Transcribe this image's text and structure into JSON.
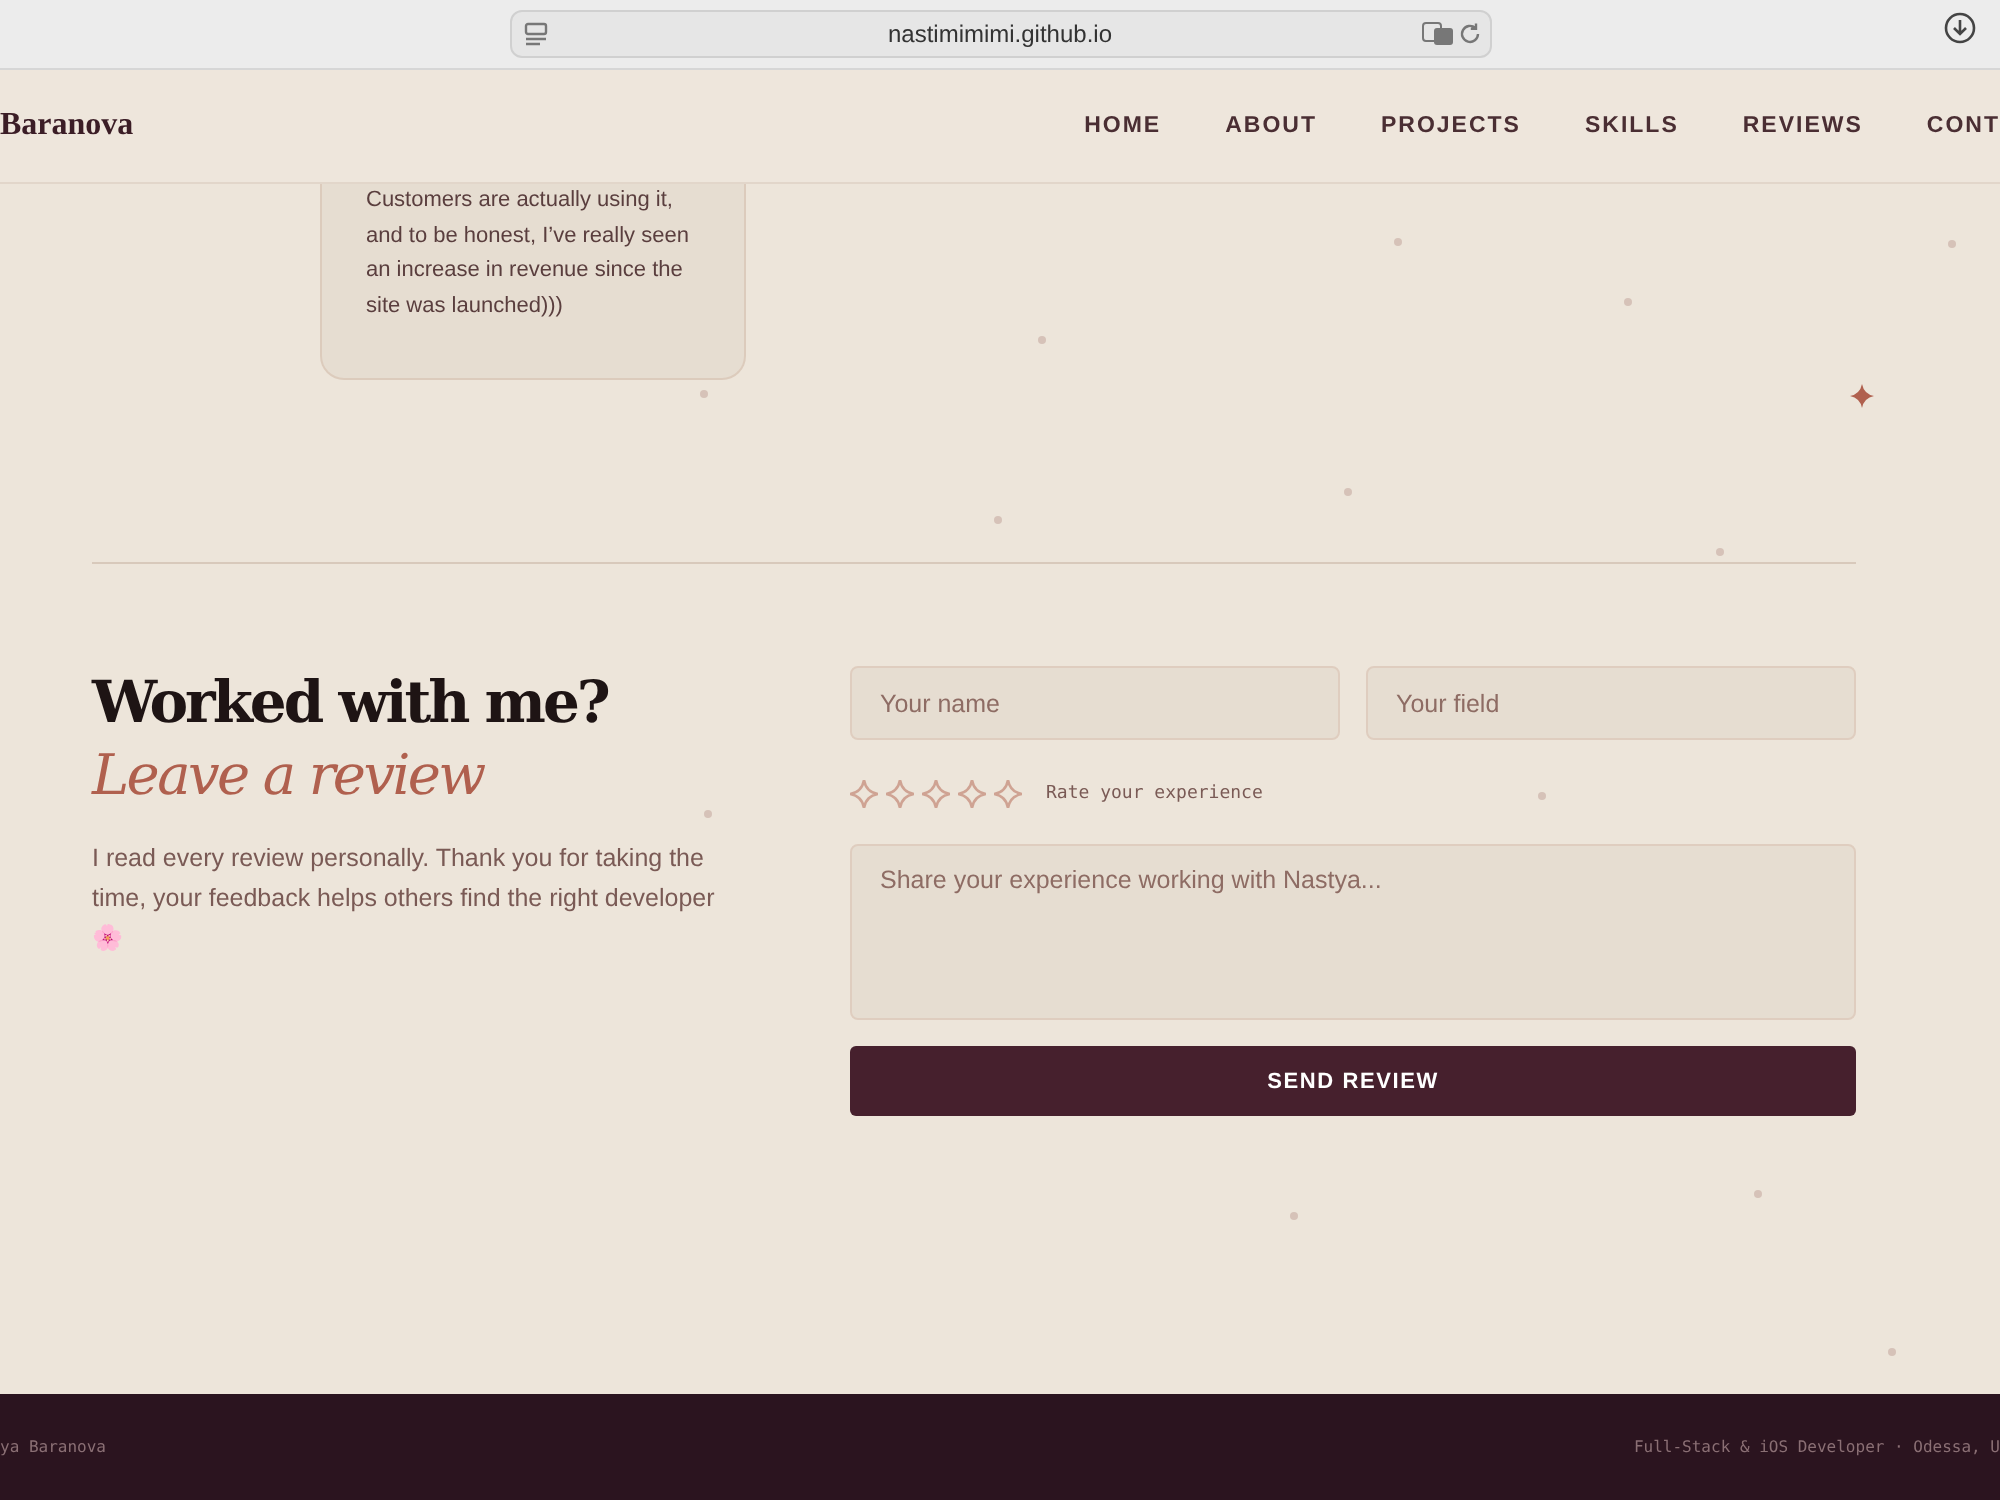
{
  "browser": {
    "address": "nastimimimi.github.io"
  },
  "header": {
    "logo": "Baranova",
    "nav": [
      {
        "label": "HOME"
      },
      {
        "label": "ABOUT"
      },
      {
        "label": "PROJECTS"
      },
      {
        "label": "SKILLS"
      },
      {
        "label": "REVIEWS"
      },
      {
        "label": "CONT"
      }
    ]
  },
  "review_card": {
    "text": "Customers are actually using it, and to be honest, I’ve really seen an increase in revenue since the site was launched)))"
  },
  "review_form": {
    "title": "Worked with me?",
    "subtitle": "Leave a review",
    "intro": "I read every review personally. Thank you for taking the time, your feedback helps others find the right developer 🌸",
    "name_field": {
      "placeholder": "Your name"
    },
    "field_field": {
      "placeholder": "Your field"
    },
    "rating": {
      "stars": 0,
      "label": "Rate your experience"
    },
    "message": {
      "placeholder": "Share your experience working with Nastya..."
    },
    "submit": "SEND REVIEW"
  },
  "footer": {
    "left": "ya Baranova",
    "right": "Full-Stack & iOS Developer · Odessa, U"
  }
}
